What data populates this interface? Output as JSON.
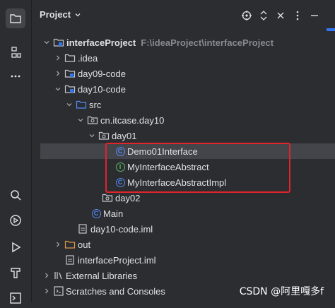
{
  "panel": {
    "title": "Project",
    "title_caret": "⌄"
  },
  "tree": {
    "root": {
      "label": "interfaceProject",
      "path": "F:\\ideaProject\\interfaceProject"
    },
    "idea": "idea",
    "day09": "day09-code",
    "day10": "day10-code",
    "src": "src",
    "package": "cn.itcase.day10",
    "day01": "day01",
    "demo01": "Demo01Interface",
    "abstract": "MyInterfaceAbstract",
    "impl": "MyInterfaceAbstractImpl",
    "day02": "day02",
    "main": "Main",
    "iml10": "day10-code.iml",
    "out": "out",
    "imlRoot": "interfaceProject.iml",
    "extlib": "External Libraries",
    "scratches": "Scratches and Consoles"
  },
  "watermark": "CSDN @阿里嘎多f",
  "colors": {
    "background": "#2b2d30",
    "text": "#dfe1e5",
    "path_text": "#868a91",
    "class_icon": "#548af7",
    "interface_icon": "#5fb865",
    "highlight_box": "#e0242b",
    "selection": "#43454a",
    "folder_orange": "#d99a47"
  },
  "icons": {
    "activity": [
      "project-icon",
      "structure-icon",
      "more-icon",
      "search-icon",
      "run-services-icon",
      "run-icon",
      "build-icon",
      "terminal-icon"
    ],
    "header": [
      "locate-icon",
      "expand-collapse-icon",
      "close-icon",
      "more-vertical-icon",
      "minimize-icon"
    ]
  }
}
